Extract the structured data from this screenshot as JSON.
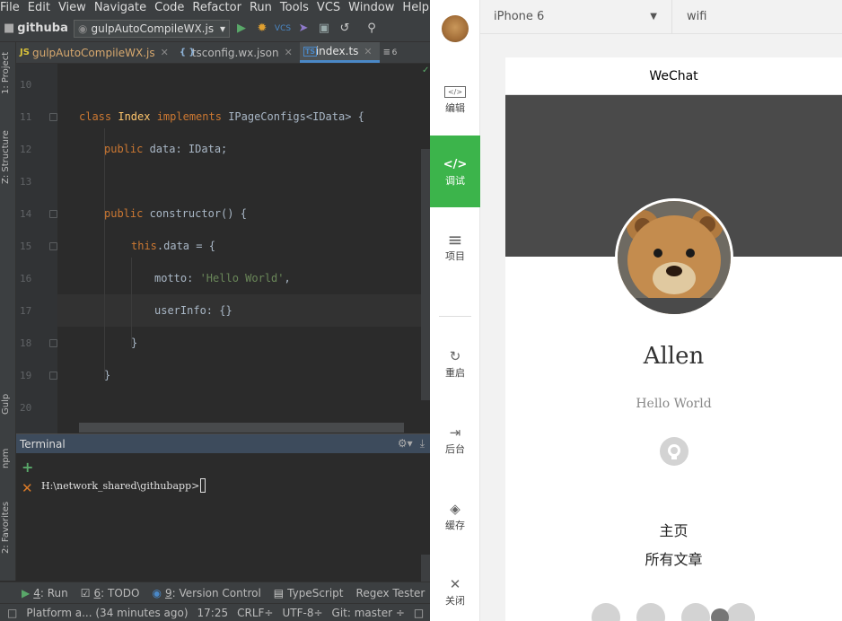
{
  "menubar": [
    "File",
    "Edit",
    "View",
    "Navigate",
    "Code",
    "Refactor",
    "Run",
    "Tools",
    "VCS",
    "Window",
    "Help"
  ],
  "toolbar": {
    "project": "githubap",
    "run_config": "gulpAutoCompileWX.js"
  },
  "tabs": [
    {
      "ext": "JS",
      "label": "gulpAutoCompileWX.js",
      "active": false
    },
    {
      "ext": "{ }",
      "label": "tsconfig.wx.json",
      "active": false
    },
    {
      "ext": "TS",
      "label": "index.ts",
      "active": true
    },
    {
      "ext": "≡",
      "label": "6",
      "active": false
    }
  ],
  "left_strip": [
    "1: Project",
    "Z: Structure",
    "Gulp",
    "npm",
    "2: Favorites"
  ],
  "line_numbers": [
    "10",
    "11",
    "12",
    "13",
    "14",
    "15",
    "16",
    "17",
    "18",
    "19",
    "20"
  ],
  "code": {
    "l11_kw1": "class ",
    "l11_name": "Index",
    "l11_kw2": " implements ",
    "l11_rest": "IPageConfigs<IData> {",
    "l12_kw": "public ",
    "l12_rest": "data: IData;",
    "l14_kw": "public ",
    "l14_rest": "constructor() {",
    "l15_kw": "this",
    "l15_rest": ".data = {",
    "l16_key": "motto: ",
    "l16_str": "'Hello World'",
    "l16_end": ",",
    "l17": "userInfo: {}",
    "l18": "}",
    "l19": "}"
  },
  "terminal": {
    "title": "Terminal",
    "prompt": "H:\\network_shared\\githubapp>"
  },
  "bottom_tools": [
    {
      "num": "4",
      "label": ": Run"
    },
    {
      "num": "6",
      "label": ": TODO"
    },
    {
      "num": "9",
      "label": ": Version Control"
    },
    {
      "num": "",
      "label": "TypeScript"
    },
    {
      "num": "",
      "label": "Regex Tester"
    }
  ],
  "status": {
    "message": "Platform a... (34 minutes ago)",
    "position": "17:25",
    "line_sep": "CRLF÷",
    "encoding": "UTF-8÷",
    "git": "Git: master ÷"
  },
  "sim_sidebar": [
    {
      "label": "编辑",
      "icon": "</>"
    },
    {
      "label": "调试",
      "icon": "</>"
    },
    {
      "label": "项目",
      "icon": "≡"
    },
    {
      "label": "重启",
      "icon": "↻"
    },
    {
      "label": "后台",
      "icon": "⇥"
    },
    {
      "label": "缓存",
      "icon": "◈"
    },
    {
      "label": "关闭",
      "icon": "✕"
    }
  ],
  "sim_top": {
    "device": "iPhone 6",
    "network": "wifi"
  },
  "phone": {
    "nav_title": "WeChat",
    "username": "Allen",
    "motto": "Hello World",
    "menu": [
      "主页",
      "所有文章"
    ]
  }
}
